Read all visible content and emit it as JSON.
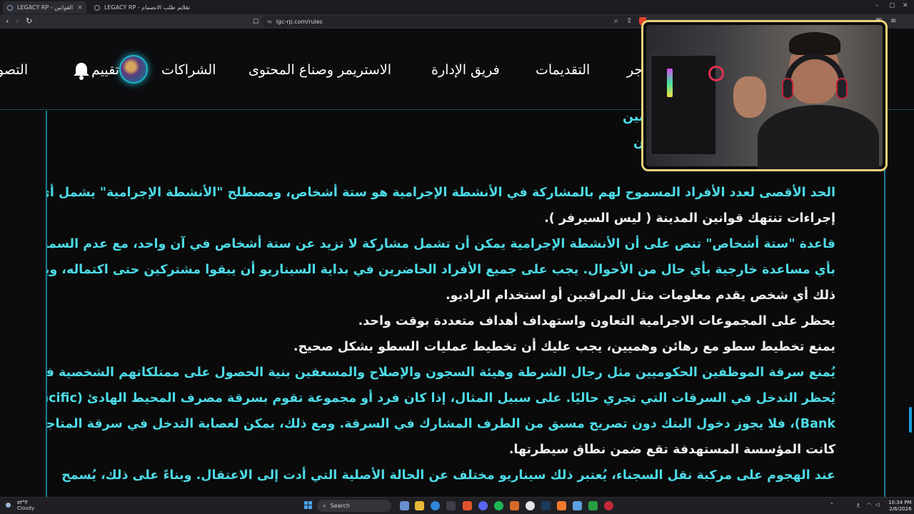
{
  "browser": {
    "tabs": [
      {
        "title": "LEGACY RP - القوانين",
        "active": true
      },
      {
        "title": "LEGACY RP - تقديم طلب الانضمام",
        "active": false
      }
    ],
    "new_tab": "+",
    "window_controls": [
      "–",
      "▢",
      "✕"
    ],
    "back": "‹",
    "forward": "›",
    "reload": "↻",
    "bookmark": "☐",
    "lock": "⇋",
    "url": "lgc-rp.com/rules"
  },
  "site_nav": {
    "items": [
      {
        "label": "جر",
        "name": "nav-item-partial-right"
      },
      {
        "label": "التقديمات",
        "name": "nav-item-applications"
      },
      {
        "label": "فريق الإدارة",
        "name": "nav-item-admin-team"
      },
      {
        "label": "الاستريمر وصناع المحتوى",
        "name": "nav-item-streamers"
      },
      {
        "label": "الشراكات",
        "name": "nav-item-partnerships"
      },
      {
        "label": "تقييم",
        "name": "nav-item-rating"
      },
      {
        "label": "التصو",
        "name": "nav-item-partial-left"
      }
    ]
  },
  "rules_text": {
    "lines": [
      {
        "text": "لاعبين",
        "color": "cyan"
      },
      {
        "text": "لاعبين",
        "color": "cyan"
      },
      {
        "text": "الحد الأقصى لعدد الأفراد المسموح لهم بالمشاركة في الأنشطة الإجرامية هو ستة أشخاص، ومصطلح \"الأنشطة الإجرامية\" يشمل أي",
        "color": "cyan"
      },
      {
        "text": "إجراءات تنتهك قوانين المدينة ( ليس السيرفر ).",
        "color": "white"
      },
      {
        "text": "قاعدة \"ستة أشخاص\" تنص على أن الأنشطة الإجرامية يمكن أن تشمل مشاركة لا تزيد عن ستة أشخاص في آن واحد، مع عدم السماح",
        "color": "cyan"
      },
      {
        "text": "بأي مساعدة خارجية بأي حال من الأحوال. يجب على جميع الأفراد الحاضرين في بداية السيناريو أن يبقوا مشتركين حتى اكتماله، ويشمل",
        "color": "cyan"
      },
      {
        "text": "ذلك أي شخص يقدم معلومات مثل المراقبين أو استخدام الراديو.",
        "color": "white"
      },
      {
        "text": "يحظر على المجموعات الاجرامية التعاون واستهداف أهداف متعددة بوقت واحد.",
        "color": "white"
      },
      {
        "text": "يمنع تخطيط سطو مع رهائن وهميين، يجب عليك أن تخطيط عمليات السطو بشكل صحيح.",
        "color": "white"
      },
      {
        "text": "يُمنع سرقة الموظفين الحكوميين مثل رجال الشرطة وهيئة السجون والإصلاح والمسعفين بنية الحصول على ممتلكاتهم الشخصية فقط.",
        "color": "cyan"
      },
      {
        "text": "يُحظر التدخل في السرقات التي تجري حاليًا. على سبيل المثال، إذا كان فرد أو مجموعة تقوم بسرقة مصرف المحيط الهادئ (Pacific",
        "color": "cyan"
      },
      {
        "text": "Bank)، فلا يجوز دخول البنك دون تصريح مسبق من الطرف المشارك في السرقة. ومع ذلك، يمكن لعصابة التدخل في سرقة المتاجر إذا",
        "color": "cyan"
      },
      {
        "text": "كانت المؤسسة المستهدفة تقع ضمن نطاق سيطرتها.",
        "color": "white"
      },
      {
        "text": "عند الهجوم على مركبة نقل السجناء، يُعتبر ذلك سيناريو مختلف عن الحالة الأصلية التي أدت إلى الاعتقال. وبناءً على ذلك، يُسمح",
        "color": "cyan"
      }
    ]
  },
  "taskbar": {
    "weather_temp": "٥٣°F",
    "weather_text": "Cloudy",
    "search_placeholder": "Search",
    "time": "10:34 PM",
    "date": "2/6/2026",
    "lang": "ع"
  },
  "colors": {
    "accent": "#4ddbe7",
    "border": "#1c7f98",
    "header_bg": "#0c0c0f"
  }
}
